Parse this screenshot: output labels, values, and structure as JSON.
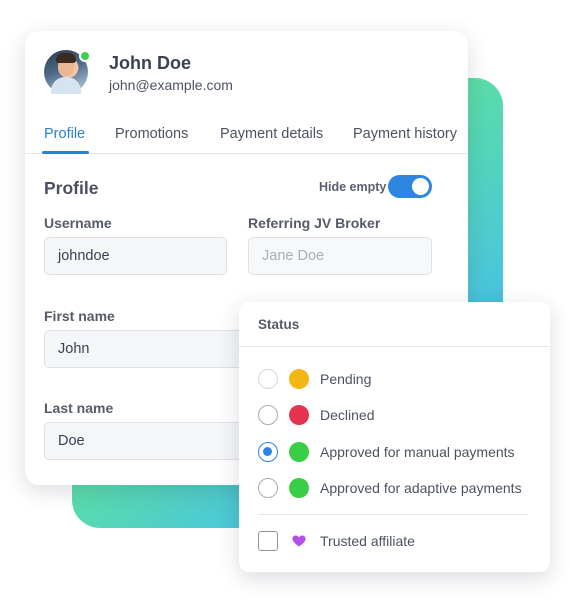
{
  "user": {
    "name": "John Doe",
    "email": "john@example.com",
    "online": true
  },
  "tabs": [
    {
      "label": "Profile",
      "active": true
    },
    {
      "label": "Promotions",
      "active": false
    },
    {
      "label": "Payment details",
      "active": false
    },
    {
      "label": "Payment history",
      "active": false
    }
  ],
  "profile": {
    "title": "Profile",
    "hide_empty_label": "Hide empty",
    "hide_empty_on": true,
    "fields": {
      "username": {
        "label": "Username",
        "value": "johndoe"
      },
      "referring_broker": {
        "label": "Referring JV Broker",
        "placeholder": "Jane Doe"
      },
      "first_name": {
        "label": "First name",
        "value": "John"
      },
      "last_name": {
        "label": "Last name",
        "value": "Doe"
      }
    }
  },
  "status_popover": {
    "title": "Status",
    "options": [
      {
        "label": "Pending",
        "color": "#f2b811",
        "selected": false
      },
      {
        "label": "Declined",
        "color": "#e5334e",
        "selected": false
      },
      {
        "label": "Approved for manual payments",
        "color": "#38cf46",
        "selected": true
      },
      {
        "label": "Approved for adaptive payments",
        "color": "#38cf46",
        "selected": false
      }
    ],
    "trusted": {
      "label": "Trusted affiliate",
      "checked": false,
      "icon": "heart-icon",
      "icon_color": "#b24fe8"
    }
  },
  "colors": {
    "accent": "#2d86e0",
    "gradient_start": "#8ef77a",
    "gradient_end": "#3a8ff5"
  }
}
